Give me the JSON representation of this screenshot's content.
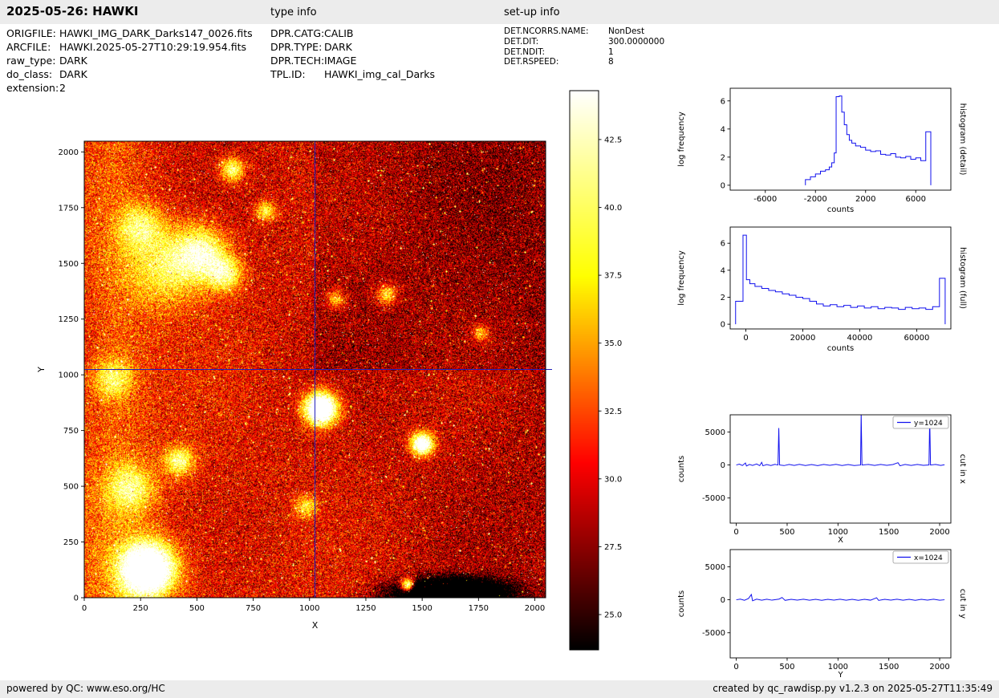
{
  "header": {
    "title": "2025-05-26: HAWKI",
    "type_info_heading": "type info",
    "setup_info_heading": "set-up info"
  },
  "metadata": {
    "file_info": [
      {
        "label": "ORIGFILE:",
        "value": "HAWKI_IMG_DARK_Darks147_0026.fits"
      },
      {
        "label": "ARCFILE:",
        "value": "HAWKI.2025-05-27T10:29:19.954.fits"
      },
      {
        "label": "raw_type:",
        "value": "DARK"
      },
      {
        "label": "do_class:",
        "value": "DARK"
      },
      {
        "label": "extension:",
        "value": "2"
      }
    ],
    "type_info": [
      {
        "label": "DPR.CATG:",
        "value": "CALIB"
      },
      {
        "label": "DPR.TYPE:",
        "value": "DARK"
      },
      {
        "label": "DPR.TECH:",
        "value": "IMAGE"
      },
      {
        "label": "TPL.ID:",
        "value": "HAWKI_img_cal_Darks"
      }
    ],
    "setup_info": [
      {
        "label": "DET.NCORRS.NAME:",
        "value": "NonDest"
      },
      {
        "label": "DET.DIT:",
        "value": "300.0000000"
      },
      {
        "label": "DET.NDIT:",
        "value": "1"
      },
      {
        "label": "DET.RSPEED:",
        "value": "8"
      }
    ]
  },
  "footer": {
    "left": "powered by QC: www.eso.org/HC",
    "right": "created by qc_rawdisp.py v1.2.3 on 2025-05-27T11:35:49"
  },
  "chart_data": [
    {
      "id": "main-image",
      "type": "heatmap",
      "description": "HAWKI raw dark frame 2048x2048, hot colormap, noisy with hot pixels and bright blobs, crosshair cuts at 1024",
      "xlabel": "X",
      "ylabel": "Y",
      "xlim": [
        0,
        2048
      ],
      "ylim": [
        0,
        2048
      ],
      "xticks": [
        0,
        250,
        500,
        750,
        1000,
        1250,
        1500,
        1750,
        2000
      ],
      "yticks": [
        0,
        250,
        500,
        750,
        1000,
        1250,
        1500,
        1750,
        2000
      ],
      "crosshair": {
        "x": 1024,
        "y": 1024,
        "color": "#2222bb"
      },
      "colormap": "hot",
      "colormap_stops": [
        "#000000",
        "#820000",
        "#fa0000",
        "#ff8000",
        "#ffff08",
        "#ffff7d",
        "#ffffff"
      ],
      "colorbar": {
        "vmin": 23.7,
        "vmax": 44.3,
        "ticks": [
          42.5,
          40.0,
          37.5,
          35.0,
          32.5,
          30.0,
          27.5,
          25.0
        ]
      }
    },
    {
      "id": "hist-detail",
      "type": "histogram-step",
      "xlabel": "counts",
      "ylabel": "log frequency",
      "side_label": "histogram (detail)",
      "xlim": [
        -8800,
        8800
      ],
      "ylim": [
        -0.35,
        6.9
      ],
      "xticks": [
        -6000,
        -2000,
        2000,
        6000
      ],
      "yticks": [
        0,
        2,
        4,
        6
      ],
      "color": "#1111ee",
      "bin_edges": [
        -2800,
        -2400,
        -2000,
        -1600,
        -1200,
        -900,
        -700,
        -500,
        -350,
        -100,
        100,
        300,
        500,
        700,
        900,
        1200,
        1600,
        2000,
        2400,
        2800,
        3200,
        3600,
        4000,
        4400,
        4800,
        5200,
        5600,
        6000,
        6400,
        6800,
        7200
      ],
      "bin_heights": [
        0.4,
        0.6,
        0.8,
        1.0,
        1.1,
        1.3,
        1.6,
        2.3,
        6.3,
        6.35,
        5.2,
        4.3,
        3.6,
        3.2,
        3.0,
        2.8,
        2.7,
        2.5,
        2.4,
        2.45,
        2.2,
        2.15,
        2.25,
        2.0,
        1.95,
        2.05,
        1.85,
        1.95,
        1.75,
        3.8
      ]
    },
    {
      "id": "hist-full",
      "type": "histogram-step",
      "xlabel": "counts",
      "ylabel": "log frequency",
      "side_label": "histogram (full)",
      "xlim": [
        -5500,
        72000
      ],
      "ylim": [
        -0.35,
        7.2
      ],
      "xticks": [
        0,
        20000,
        40000,
        60000
      ],
      "yticks": [
        0,
        2,
        4,
        6
      ],
      "color": "#1111ee",
      "bin_edges": [
        -3600,
        -1000,
        200,
        1400,
        3200,
        5600,
        8000,
        10400,
        12800,
        15200,
        17600,
        20000,
        22400,
        24800,
        27200,
        29600,
        32000,
        34400,
        36800,
        39200,
        41600,
        44000,
        46400,
        48800,
        51200,
        53600,
        56000,
        58400,
        60800,
        63200,
        65600,
        68000,
        70000
      ],
      "bin_heights": [
        1.7,
        6.6,
        3.3,
        3.0,
        2.8,
        2.65,
        2.5,
        2.4,
        2.25,
        2.15,
        2.0,
        1.9,
        1.7,
        1.5,
        1.35,
        1.45,
        1.3,
        1.4,
        1.25,
        1.35,
        1.2,
        1.3,
        1.15,
        1.25,
        1.2,
        1.1,
        1.25,
        1.15,
        1.2,
        1.1,
        1.3,
        3.4
      ]
    },
    {
      "id": "cut-x",
      "type": "line",
      "xlabel": "X",
      "ylabel": "counts",
      "side_label": "cut in x",
      "legend": "y=1024",
      "xlim": [
        -60,
        2110
      ],
      "ylim": [
        -8800,
        7600
      ],
      "xticks": [
        0,
        500,
        1000,
        1500,
        2000
      ],
      "yticks": [
        -5000,
        0,
        5000
      ],
      "color": "#1111ee",
      "x": [
        0,
        30,
        60,
        90,
        100,
        130,
        160,
        200,
        230,
        250,
        262,
        300,
        340,
        380,
        410,
        418,
        426,
        470,
        520,
        570,
        620,
        680,
        740,
        800,
        860,
        920,
        980,
        1040,
        1100,
        1160,
        1222,
        1228,
        1236,
        1300,
        1360,
        1420,
        1480,
        1540,
        1590,
        1610,
        1660,
        1720,
        1780,
        1840,
        1895,
        1902,
        1910,
        1960,
        2010,
        2048
      ],
      "y": [
        0,
        120,
        -80,
        300,
        -150,
        80,
        -60,
        150,
        -100,
        400,
        -120,
        60,
        -80,
        100,
        0,
        5600,
        0,
        -90,
        80,
        -60,
        100,
        -80,
        60,
        -100,
        80,
        -60,
        100,
        -80,
        60,
        -90,
        0,
        7800,
        0,
        80,
        -70,
        90,
        -60,
        70,
        350,
        -120,
        80,
        -70,
        90,
        -60,
        0,
        7200,
        0,
        80,
        -70,
        40
      ]
    },
    {
      "id": "cut-y",
      "type": "line",
      "xlabel": "Y",
      "ylabel": "counts",
      "side_label": "cut in y",
      "legend": "x=1024",
      "xlim": [
        -60,
        2110
      ],
      "ylim": [
        -8800,
        7600
      ],
      "xticks": [
        0,
        500,
        1000,
        1500,
        2000
      ],
      "yticks": [
        -5000,
        0,
        5000
      ],
      "color": "#1111ee",
      "x": [
        0,
        40,
        80,
        120,
        148,
        160,
        200,
        250,
        300,
        350,
        420,
        450,
        480,
        540,
        600,
        660,
        720,
        780,
        840,
        900,
        960,
        1020,
        1080,
        1140,
        1200,
        1260,
        1320,
        1380,
        1400,
        1460,
        1520,
        1580,
        1640,
        1700,
        1760,
        1820,
        1880,
        1940,
        2000,
        2048
      ],
      "y": [
        0,
        100,
        -80,
        200,
        800,
        -150,
        90,
        -70,
        80,
        -60,
        100,
        350,
        -90,
        70,
        -60,
        80,
        -70,
        60,
        -80,
        70,
        -60,
        80,
        -70,
        60,
        -80,
        70,
        -60,
        300,
        -100,
        70,
        -60,
        80,
        -70,
        60,
        -80,
        70,
        -60,
        80,
        -70,
        0
      ]
    }
  ]
}
